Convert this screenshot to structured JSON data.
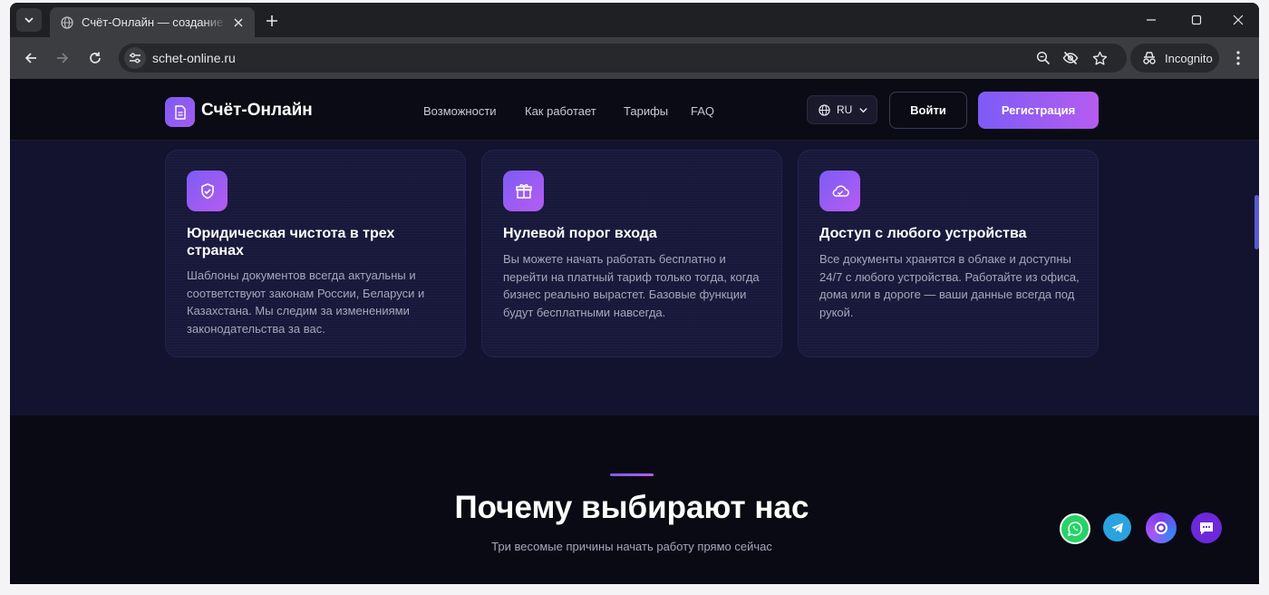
{
  "browser": {
    "tab_title": "Счёт-Онлайн — создание счетов",
    "url": "schet-online.ru",
    "incognito_label": "Incognito"
  },
  "site": {
    "logo_text": "Счёт-Онлайн",
    "nav": [
      "Возможности",
      "Как работает",
      "Тарифы",
      "FAQ"
    ],
    "lang": "RU",
    "login": "Войти",
    "register": "Регистрация"
  },
  "features": [
    {
      "icon": "shield-check-icon",
      "title": "Юридическая чистота в трех странах",
      "text": "Шаблоны документов всегда актуальны и соответствуют законам России, Беларуси и Казахстана. Мы следим за изменениями законодательства за вас."
    },
    {
      "icon": "gift-icon",
      "title": "Нулевой порог входа",
      "text": "Вы можете начать работать бесплатно и перейти на платный тариф только тогда, когда бизнес реально вырастет. Базовые функции будут бесплатными навсегда."
    },
    {
      "icon": "cloud-icon",
      "title": "Доступ с любого устройства",
      "text": "Все документы хранятся в облаке и доступны 24/7 с любого устройства. Работайте из офиса, дома или в дороге — ваши данные всегда под рукой."
    }
  ],
  "why": {
    "title": "Почему выбирают нас",
    "subtitle": "Три весомые причины начать работу прямо сейчас"
  },
  "colors": {
    "accent_start": "#7c5cf6",
    "accent_end": "#b65cf0",
    "whatsapp": "#25d366",
    "telegram": "#2aa3e0"
  }
}
